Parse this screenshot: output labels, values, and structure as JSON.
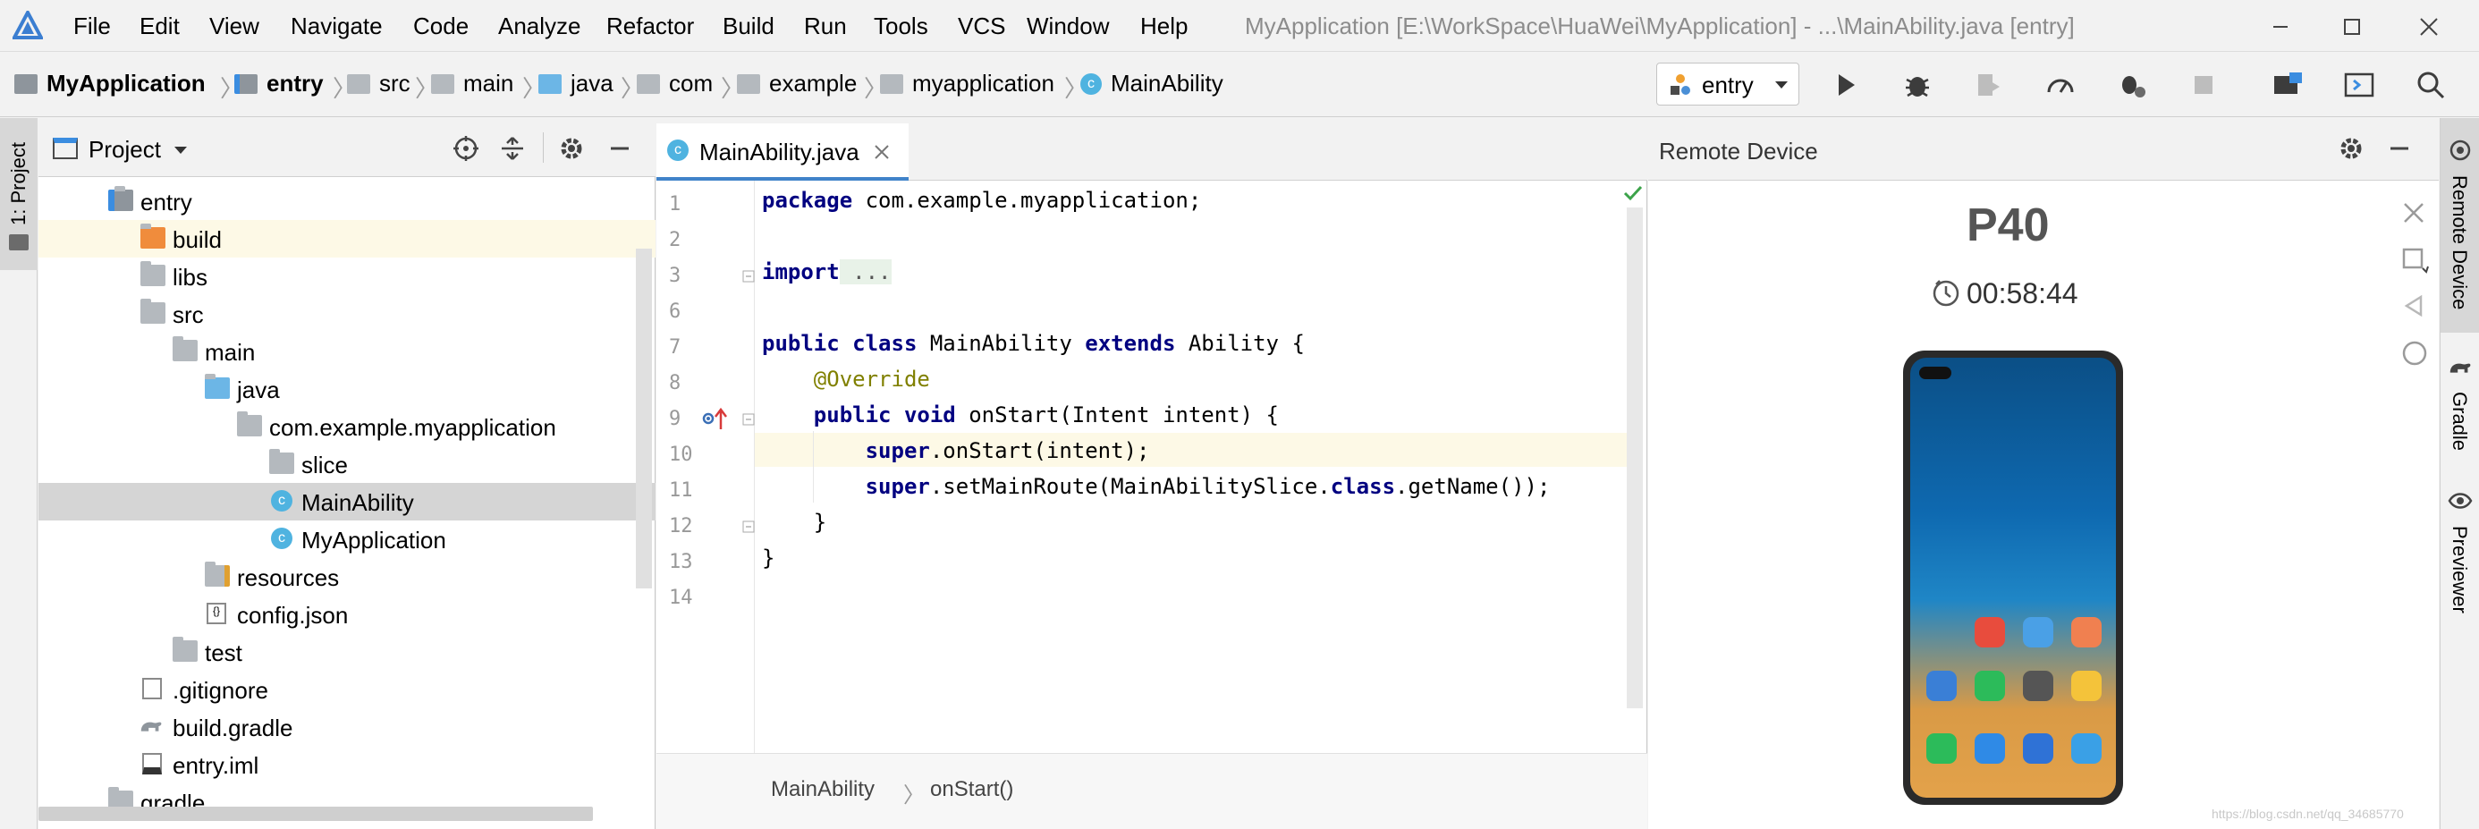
{
  "menubar": {
    "items": [
      "File",
      "Edit",
      "View",
      "Navigate",
      "Code",
      "Analyze",
      "Refactor",
      "Build",
      "Run",
      "Tools",
      "VCS",
      "Window",
      "Help"
    ],
    "window_title": "MyApplication [E:\\WorkSpace\\HuaWei\\MyApplication] - ...\\MainAbility.java [entry]"
  },
  "navbar": {
    "breadcrumbs": [
      "MyApplication",
      "entry",
      "src",
      "main",
      "java",
      "com",
      "example",
      "myapplication",
      "MainAbility"
    ],
    "run_config": "entry"
  },
  "left_strip": {
    "tab_label": "1: Project"
  },
  "project_panel": {
    "title": "Project",
    "tree": [
      {
        "label": "entry"
      },
      {
        "label": "build"
      },
      {
        "label": "libs"
      },
      {
        "label": "src"
      },
      {
        "label": "main"
      },
      {
        "label": "java"
      },
      {
        "label": "com.example.myapplication"
      },
      {
        "label": "slice"
      },
      {
        "label": "MainAbility"
      },
      {
        "label": "MyApplication"
      },
      {
        "label": "resources"
      },
      {
        "label": "config.json"
      },
      {
        "label": "test"
      },
      {
        "label": ".gitignore"
      },
      {
        "label": "build.gradle"
      },
      {
        "label": "entry.iml"
      },
      {
        "label": "gradle"
      }
    ]
  },
  "editor": {
    "tab_label": "MainAbility.java",
    "line_numbers": [
      "1",
      "2",
      "3",
      "6",
      "7",
      "8",
      "9",
      "10",
      "11",
      "12",
      "13",
      "14"
    ],
    "code": {
      "l1_kw": "package",
      "l1_rest": " com.example.myapplication;",
      "l3_kw": "import",
      "l3_rest": " ...",
      "l7_kw1": "public",
      "l7_kw2": "class",
      "l7_mid": " MainAbility ",
      "l7_kw3": "extends",
      "l7_rest": " Ability {",
      "l8_ann": "@Override",
      "l9_kw1": "public",
      "l9_kw2": "void",
      "l9_rest": " onStart(Intent intent) {",
      "l10_kw": "super",
      "l10_rest": ".onStart(intent);",
      "l11_kw": "super",
      "l11_mid": ".setMainRoute(MainAbilitySlice.",
      "l11_kw2": "class",
      "l11_rest": ".getName());",
      "l12": "}",
      "l13": "}"
    },
    "breadcrumb": [
      "MainAbility",
      "onStart()"
    ]
  },
  "remote_device": {
    "title": "Remote Device",
    "device_name": "P40",
    "timer": "00:58:44"
  },
  "right_strip": {
    "tabs": [
      "Remote Device",
      "Gradle",
      "Previewer"
    ]
  },
  "watermark": "https://blog.csdn.net/qq_34685770"
}
